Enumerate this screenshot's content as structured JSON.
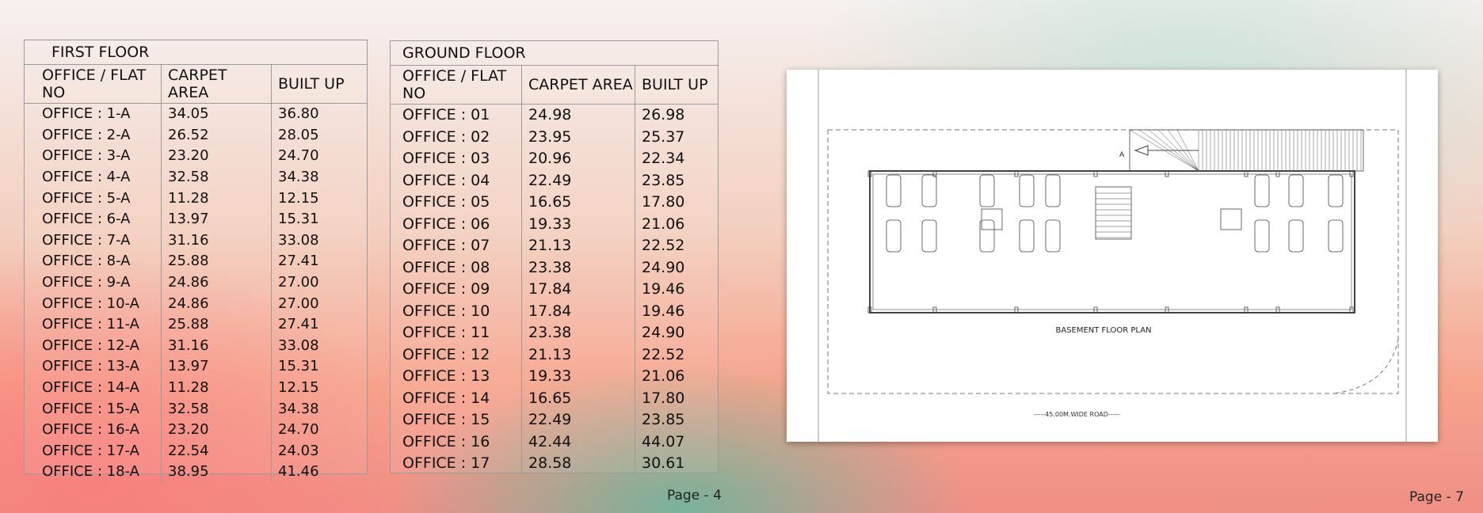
{
  "first_floor": {
    "title": "FIRST FLOOR",
    "headers": [
      "OFFICE / FLAT NO",
      "CARPET AREA",
      "BUILT UP"
    ],
    "rows": [
      [
        "OFFICE : 1-A",
        "34.05",
        "36.80"
      ],
      [
        "OFFICE : 2-A",
        "26.52",
        "28.05"
      ],
      [
        "OFFICE : 3-A",
        "23.20",
        "24.70"
      ],
      [
        "OFFICE : 4-A",
        "32.58",
        "34.38"
      ],
      [
        "OFFICE : 5-A",
        "11.28",
        "12.15"
      ],
      [
        "OFFICE : 6-A",
        "13.97",
        "15.31"
      ],
      [
        "OFFICE : 7-A",
        "31.16",
        "33.08"
      ],
      [
        "OFFICE : 8-A",
        "25.88",
        "27.41"
      ],
      [
        "OFFICE : 9-A",
        "24.86",
        "27.00"
      ],
      [
        "OFFICE : 10-A",
        "24.86",
        "27.00"
      ],
      [
        "OFFICE : 11-A",
        "25.88",
        "27.41"
      ],
      [
        "OFFICE : 12-A",
        "31.16",
        "33.08"
      ],
      [
        "OFFICE : 13-A",
        "13.97",
        "15.31"
      ],
      [
        "OFFICE : 14-A",
        "11.28",
        "12.15"
      ],
      [
        "OFFICE : 15-A",
        "32.58",
        "34.38"
      ],
      [
        "OFFICE : 16-A",
        "23.20",
        "24.70"
      ],
      [
        "OFFICE : 17-A",
        "22.54",
        "24.03"
      ],
      [
        "OFFICE : 18-A",
        "38.95",
        "41.46"
      ]
    ]
  },
  "ground_floor": {
    "title": "GROUND FLOOR",
    "headers": [
      "OFFICE / FLAT NO",
      "CARPET AREA",
      "BUILT UP"
    ],
    "rows": [
      [
        "OFFICE : 01",
        "24.98",
        "26.98"
      ],
      [
        "OFFICE : 02",
        "23.95",
        "25.37"
      ],
      [
        "OFFICE : 03",
        "20.96",
        "22.34"
      ],
      [
        "OFFICE : 04",
        "22.49",
        "23.85"
      ],
      [
        "OFFICE : 05",
        "16.65",
        "17.80"
      ],
      [
        "OFFICE : 06",
        "19.33",
        "21.06"
      ],
      [
        "OFFICE : 07",
        "21.13",
        "22.52"
      ],
      [
        "OFFICE : 08",
        "23.38",
        "24.90"
      ],
      [
        "OFFICE : 09",
        "17.84",
        "19.46"
      ],
      [
        "OFFICE : 10",
        "17.84",
        "19.46"
      ],
      [
        "OFFICE : 11",
        "23.38",
        "24.90"
      ],
      [
        "OFFICE : 12",
        "21.13",
        "22.52"
      ],
      [
        "OFFICE : 13",
        "19.33",
        "21.06"
      ],
      [
        "OFFICE : 14",
        "16.65",
        "17.80"
      ],
      [
        "OFFICE : 15",
        "22.49",
        "23.85"
      ],
      [
        "OFFICE : 16",
        "42.44",
        "44.07"
      ],
      [
        "OFFICE : 17",
        "28.58",
        "30.61"
      ]
    ]
  },
  "plan": {
    "title": "BASEMENT FLOOR PLAN",
    "road_label": "-----45.00M.WIDE ROAD-----",
    "ramp_marker": "A"
  },
  "pages": {
    "left": "Page - 4",
    "right": "Page - 7"
  }
}
